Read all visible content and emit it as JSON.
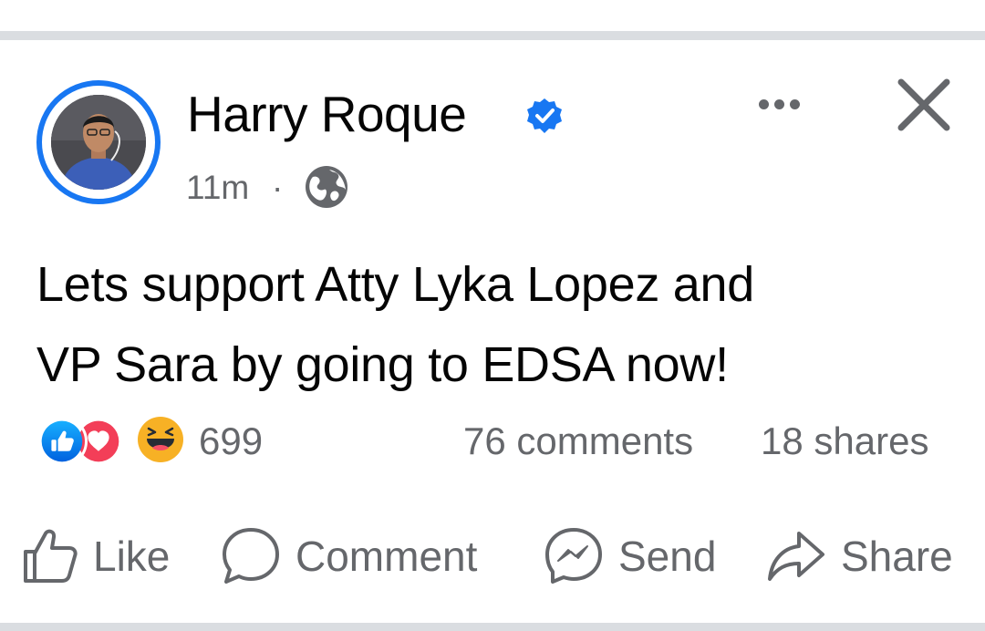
{
  "post": {
    "author": "Harry Roque",
    "time": "11m",
    "separator": "·",
    "audience_icon": "globe-icon",
    "text_line1": "Lets support Atty Lyka Lopez and",
    "text_line2": "VP Sara by going to EDSA now!"
  },
  "stats": {
    "reactions_count": "699",
    "reaction_icons": [
      "like-reaction-icon",
      "love-reaction-icon",
      "haha-reaction-icon"
    ],
    "comments": "76 comments",
    "shares": "18 shares"
  },
  "actions": {
    "like": "Like",
    "comment": "Comment",
    "send": "Send",
    "share": "Share"
  },
  "colors": {
    "accent": "#1877f2",
    "text": "#050505",
    "secondary_text": "#65676b",
    "divider": "#dadde1",
    "love": "#f33e58",
    "haha": "#f7b125"
  }
}
